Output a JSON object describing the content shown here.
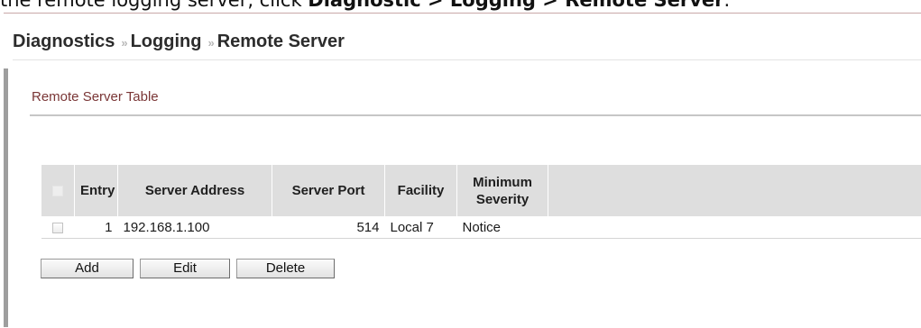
{
  "instruction": {
    "prefix": "the remote logging server, click ",
    "path_1": "Diagnostic",
    "sep_1": " > ",
    "path_2": "Logging",
    "sep_2": " > ",
    "path_3": "Remote Server",
    "suffix": "."
  },
  "breadcrumb": {
    "items": [
      "Diagnostics",
      "Logging",
      "Remote Server"
    ],
    "separator": "»"
  },
  "section": {
    "title": "Remote Server Table"
  },
  "table": {
    "columns": {
      "entry": "Entry",
      "server_address": "Server Address",
      "server_port": "Server Port",
      "facility": "Facility",
      "min_severity_line1": "Minimum",
      "min_severity_line2": "Severity"
    },
    "rows": [
      {
        "entry": "1",
        "server_address": "192.168.1.100",
        "server_port": "514",
        "facility": "Local 7",
        "min_severity": "Notice"
      }
    ]
  },
  "buttons": {
    "add": "Add",
    "edit": "Edit",
    "delete": "Delete"
  },
  "colors": {
    "section_title": "#7a3636",
    "header_bg": "#dedede"
  }
}
